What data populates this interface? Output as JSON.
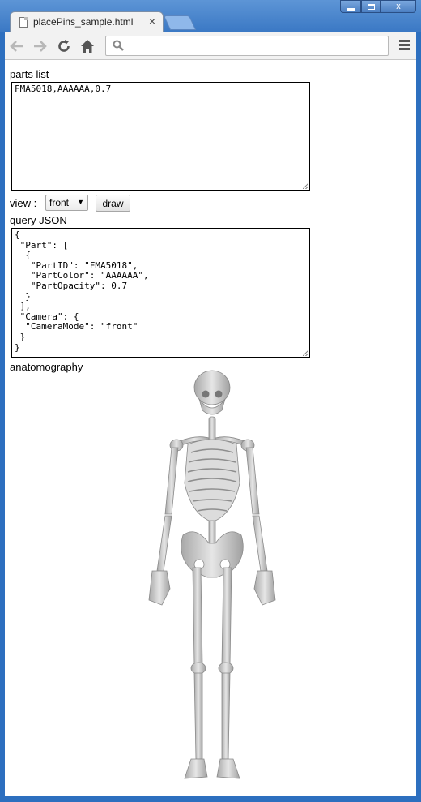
{
  "browser": {
    "tab_title": "placePins_sample.html",
    "tab_close": "×",
    "address": "",
    "window_close": "x"
  },
  "parts_list": {
    "label": "parts list",
    "value": "FMA5018,AAAAAA,0.7"
  },
  "view": {
    "label": "view :",
    "selected": "front",
    "draw_label": "draw"
  },
  "query_json": {
    "label": "query JSON",
    "value": "{\n \"Part\": [\n  {\n   \"PartID\": \"FMA5018\",\n   \"PartColor\": \"AAAAAA\",\n   \"PartOpacity\": 0.7\n  }\n ],\n \"Camera\": {\n  \"CameraMode\": \"front\"\n }\n}"
  },
  "anatomography": {
    "label": "anatomography"
  },
  "colors": {
    "frame": "#2d6fbf",
    "bone": "#c9c9c9",
    "bone_shadow": "#9a9a9a"
  }
}
